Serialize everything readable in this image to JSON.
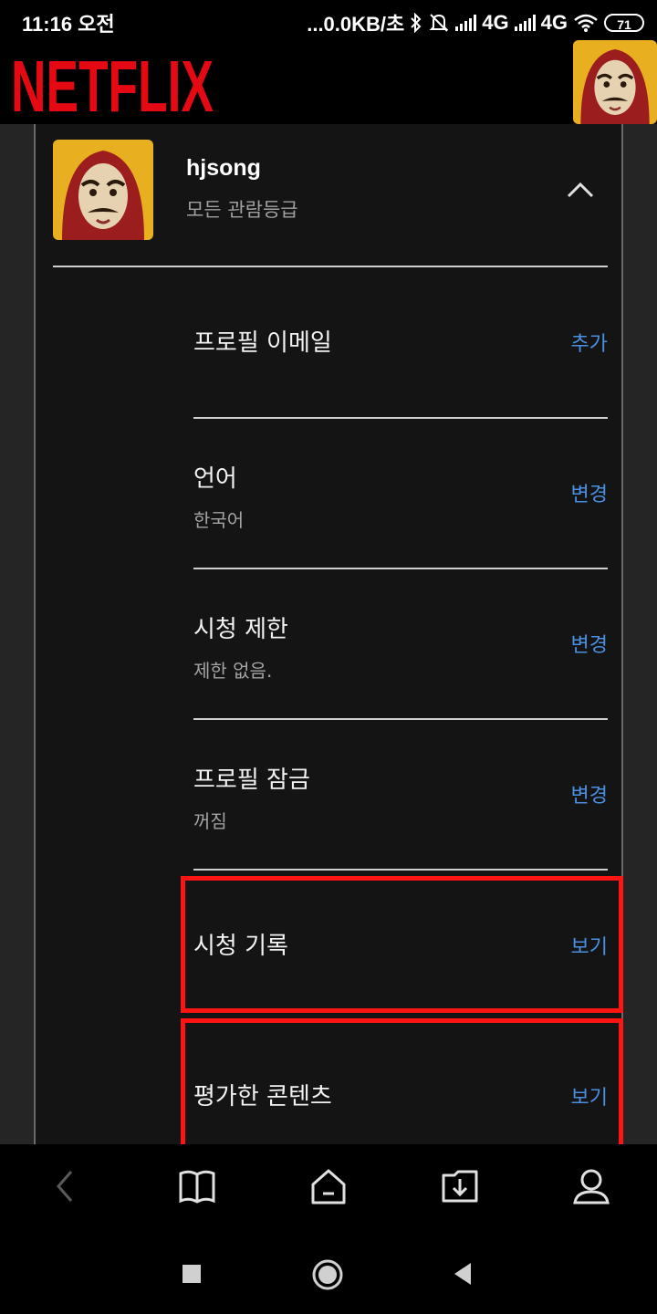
{
  "status_bar": {
    "time": "11:16 오전",
    "net_speed": "...0.0KB/초",
    "net1": "4G",
    "net2": "4G",
    "battery": "71",
    "icons": [
      "bluetooth-icon",
      "mute-icon",
      "signal-icon",
      "wifi-icon",
      "battery-icon"
    ]
  },
  "header": {
    "logo_text": "NETFLIX",
    "brand_color": "#e50914"
  },
  "profile": {
    "name": "hjsong",
    "rating": "모든 관람등급"
  },
  "settings": [
    {
      "label": "프로필 이메일",
      "sub": "",
      "action": "추가"
    },
    {
      "label": "언어",
      "sub": "한국어",
      "action": "변경"
    },
    {
      "label": "시청 제한",
      "sub": "제한 없음.",
      "action": "변경"
    },
    {
      "label": "프로필 잠금",
      "sub": "꺼짐",
      "action": "변경"
    },
    {
      "label": "시청 기록",
      "sub": "",
      "action": "보기"
    },
    {
      "label": "평가한 콘텐츠",
      "sub": "",
      "action": "보기"
    }
  ],
  "colors": {
    "link": "#4a90e2",
    "highlight": "#ff1414"
  },
  "bottom_nav": [
    "back-icon",
    "bookmarks-icon",
    "home-icon",
    "downloads-icon",
    "account-icon"
  ],
  "android_nav": [
    "recents-icon",
    "home-circle-icon",
    "back-triangle-icon"
  ]
}
